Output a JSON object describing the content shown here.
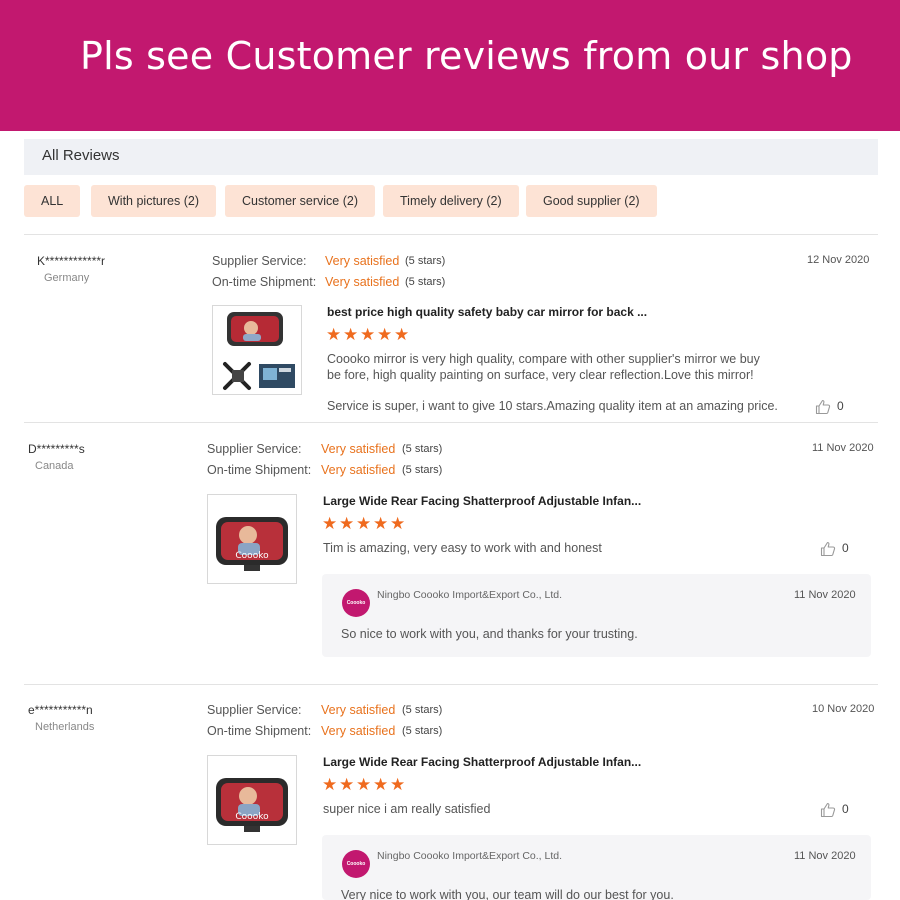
{
  "banner": {
    "title": "Pls see Customer reviews from our shop"
  },
  "header": {
    "title": "All Reviews"
  },
  "filters": [
    "ALL",
    "With pictures (2)",
    "Customer service (2)",
    "Timely delivery (2)",
    "Good supplier (2)"
  ],
  "labels": {
    "supplier_service": "Supplier Service:",
    "on_time_shipment": "On-time Shipment:"
  },
  "colors": {
    "brand": "#c2186f",
    "accent": "#e8721d",
    "chip_bg": "#fde3d5",
    "star": "#ef6a1e"
  },
  "reviews": [
    {
      "user": "K************r",
      "country": "Germany",
      "supplier_service": "Very satisfied",
      "supplier_stars": "(5 stars)",
      "on_time": "Very satisfied",
      "on_time_stars": "(5 stars)",
      "date": "12 Nov 2020",
      "product_title": "best price high quality safety baby car mirror for back ...",
      "rating": 5,
      "text": "Coooko mirror is very high quality, compare with other supplier's mirror we buy be fore, high quality painting on surface, very clear reflection.Love this mirror!",
      "text2": "Service is super, i want to give 10 stars.Amazing quality item at an amazing price.",
      "likes": "0"
    },
    {
      "user": "D*********s",
      "country": "Canada",
      "supplier_service": "Very satisfied",
      "supplier_stars": "(5 stars)",
      "on_time": "Very satisfied",
      "on_time_stars": "(5 stars)",
      "date": "11 Nov 2020",
      "product_title": "Large Wide Rear Facing Shatterproof Adjustable Infan...",
      "rating": 5,
      "text": "Tim is amazing, very easy to work with and honest",
      "likes": "0",
      "thumb_brand": "Coooko",
      "reply": {
        "seller_logo": "Coooko",
        "seller": "Ningbo Coooko Import&Export Co., Ltd.",
        "date": "11 Nov 2020",
        "text": "So nice to work with you, and thanks for your trusting."
      }
    },
    {
      "user": "e***********n",
      "country": "Netherlands",
      "supplier_service": "Very satisfied",
      "supplier_stars": "(5 stars)",
      "on_time": "Very satisfied",
      "on_time_stars": "(5 stars)",
      "date": "10 Nov 2020",
      "product_title": "Large Wide Rear Facing Shatterproof Adjustable Infan...",
      "rating": 5,
      "text": "super nice i am really satisfied",
      "likes": "0",
      "thumb_brand": "Coooko",
      "reply": {
        "seller_logo": "Coooko",
        "seller": "Ningbo Coooko Import&Export Co., Ltd.",
        "date": "11 Nov 2020",
        "text": "Very nice to work with you, our team will do our best for you."
      }
    }
  ]
}
